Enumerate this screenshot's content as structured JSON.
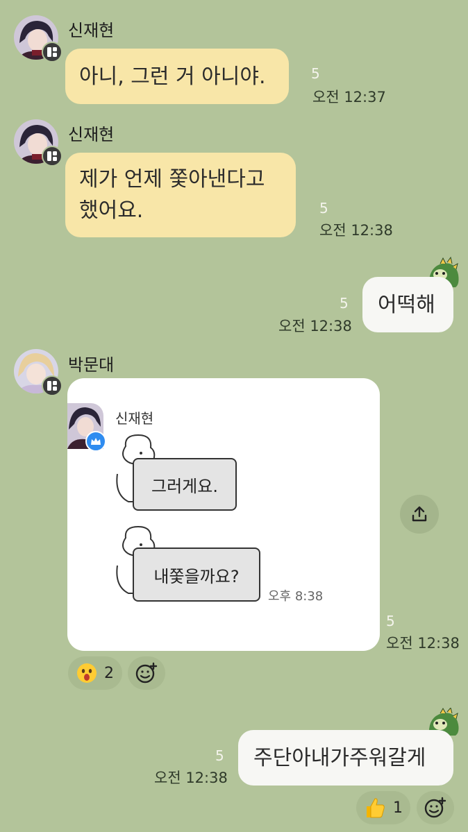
{
  "messages": [
    {
      "sender": "신재현",
      "text": "아니, 그런 거 아니야.",
      "unread": "5",
      "time": "오전 12:37"
    },
    {
      "sender": "신재현",
      "text_line1": "제가 언제 쫓아낸다고",
      "text_line2": "했어요.",
      "unread": "5",
      "time": "오전 12:38"
    },
    {
      "text": "어떡해",
      "unread": "5",
      "time": "오전 12:38"
    },
    {
      "sender": "박문대",
      "unread": "5",
      "time": "오전 12:38",
      "shared": {
        "sender": "신재현",
        "bubble1": "그러게요.",
        "bubble2": "내쫓을까요?",
        "time": "오후 8:38"
      },
      "reactions": [
        {
          "icon": "surprised-emoji",
          "count": "2"
        },
        {
          "icon": "add-reaction"
        }
      ]
    },
    {
      "text": "주단아내가주워갈게",
      "unread": "5",
      "time": "오전 12:38",
      "reactions": [
        {
          "icon": "thumbs-up-emoji",
          "count": "1"
        },
        {
          "icon": "add-reaction"
        }
      ]
    }
  ],
  "colors": {
    "background": "#b3c49a",
    "yellow_bubble": "#f8e6a8",
    "white_bubble": "#f7f7f4"
  }
}
